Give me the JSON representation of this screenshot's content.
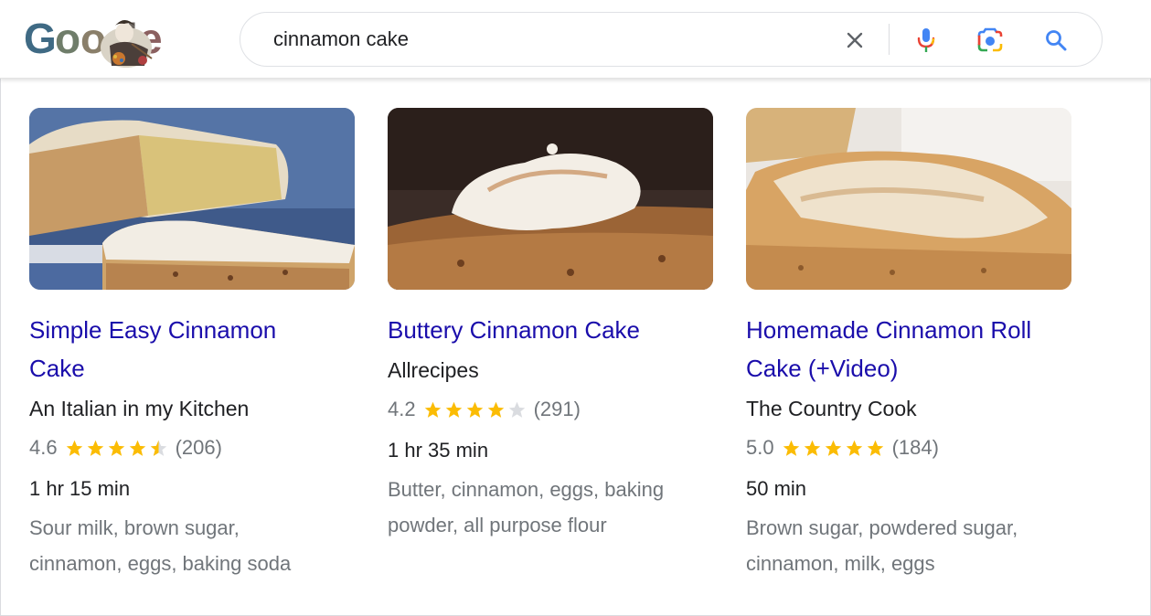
{
  "search": {
    "query": "cinnamon cake"
  },
  "icons": {
    "clear": "close-icon",
    "mic": "microphone-icon",
    "lens": "camera-lens-icon",
    "search": "search-icon"
  },
  "colors": {
    "link": "#1a0dab",
    "star": "#fbbc04",
    "star_empty": "#dadce0",
    "meta": "#70757a"
  },
  "recipes": [
    {
      "title_line1": "Simple Easy Cinnamon",
      "title_line2": "Cake",
      "source": "An Italian in my Kitchen",
      "rating": "4.6",
      "rating_value": 4.6,
      "reviews": "(206)",
      "time": "1 hr 15 min",
      "ingredients_line1": "Sour milk, brown sugar,",
      "ingredients_line2": "cinnamon, eggs, baking soda"
    },
    {
      "title_line1": "Buttery Cinnamon Cake",
      "source": "Allrecipes",
      "rating": "4.2",
      "rating_value": 4.2,
      "reviews": "(291)",
      "time": "1 hr 35 min",
      "ingredients_line1": "Butter, cinnamon, eggs, baking",
      "ingredients_line2": "powder, all purpose flour"
    },
    {
      "title_line1": "Homemade Cinnamon Roll",
      "title_line2": "Cake (+Video)",
      "source": "The Country Cook",
      "rating": "5.0",
      "rating_value": 5.0,
      "reviews": "(184)",
      "time": "50 min",
      "ingredients_line1": "Brown sugar, powdered sugar,",
      "ingredients_line2": "cinnamon, milk, eggs"
    }
  ]
}
